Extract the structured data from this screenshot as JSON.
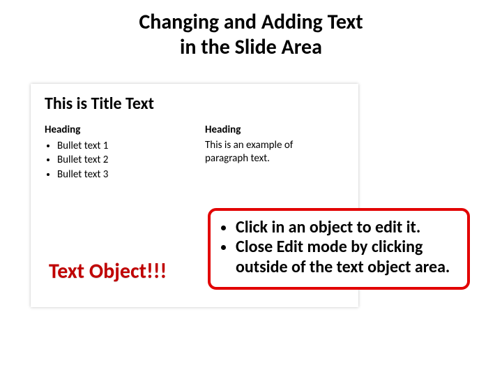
{
  "main_title_line1": "Changing and Adding Text",
  "main_title_line2": "in the Slide Area",
  "slide": {
    "title": "This is Title Text",
    "left": {
      "heading": "Heading",
      "bullets": [
        "Bullet text 1",
        "Bullet text 2",
        "Bullet text 3"
      ]
    },
    "right": {
      "heading": "Heading",
      "paragraph": "This is an example of paragraph text."
    },
    "text_object": "Text Object!!!"
  },
  "callout": {
    "bullets": [
      "Click in an object to edit it.",
      "Close Edit mode by clicking outside of the text object area."
    ]
  }
}
